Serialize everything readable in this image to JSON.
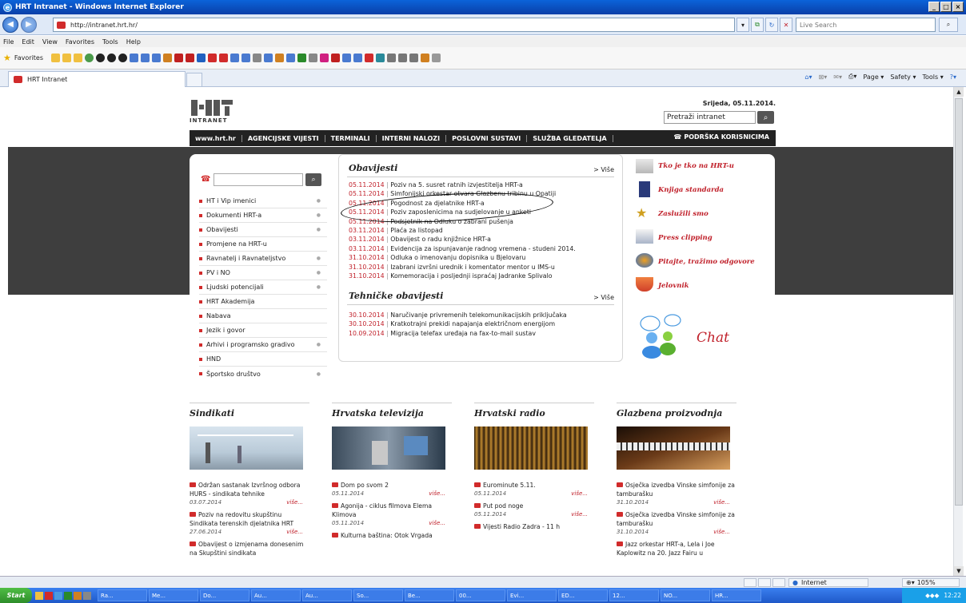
{
  "browser": {
    "title": "HRT Intranet - Windows Internet Explorer",
    "url": "http://intranet.hrt.hr/",
    "live_search_placeholder": "Live Search",
    "menu": [
      "File",
      "Edit",
      "View",
      "Favorites",
      "Tools",
      "Help"
    ],
    "favorites_label": "Favorites",
    "tab_title": "HRT Intranet",
    "command_bar": [
      "Page ▾",
      "Safety ▾",
      "Tools ▾"
    ],
    "status_zone": "Internet",
    "zoom": "105%"
  },
  "header": {
    "logo_text": "INTRANET",
    "date": "Srijeda, 05.11.2014.",
    "search_value": "Pretraži intranet",
    "nav": [
      "www.hrt.hr",
      "AGENCIJSKE VIJESTI",
      "TERMINALI",
      "INTERNI NALOZI",
      "POSLOVNI SUSTAVI",
      "SLUŽBA GLEDATELJA"
    ],
    "support": "PODRŠKA KORISNICIMA"
  },
  "sidenav": [
    "HT i Vip imenici",
    "Dokumenti HRT-a",
    "Obavijesti",
    "Promjene na HRT-u",
    "Ravnatelj i Ravnateljstvo",
    "PV i NO",
    "Ljudski potencijali",
    "HRT Akademija",
    "Nabava",
    "Jezik i govor",
    "Arhivi i programsko gradivo",
    "HND",
    "Športsko društvo"
  ],
  "obavijesti": {
    "title": "Obavijesti",
    "more": "> Više",
    "items": [
      {
        "date": "05.11.2014",
        "text": "Poziv na 5. susret ratnih izvjestitelja HRT-a"
      },
      {
        "date": "05.11.2014",
        "text": "Simfonijski orkestar otvara Glazbenu tribinu u Opatiji"
      },
      {
        "date": "05.11.2014",
        "text": "Pogodnost za djelatnike HRT-a"
      },
      {
        "date": "05.11.2014",
        "text": "Poziv zaposlenicima na sudjelovanje u anketi"
      },
      {
        "date": "05.11.2014",
        "text": "Podsjetnik na Odluku o zabrani pušenja"
      },
      {
        "date": "03.11.2014",
        "text": "Plaća za listopad"
      },
      {
        "date": "03.11.2014",
        "text": "Obavijest o radu knjižnice HRT-a"
      },
      {
        "date": "03.11.2014",
        "text": "Evidencija za ispunjavanje radnog vremena - studeni 2014."
      },
      {
        "date": "31.10.2014",
        "text": "Odluka o imenovanju dopisnika u Bjelovaru"
      },
      {
        "date": "31.10.2014",
        "text": "Izabrani izvršni urednik i komentator mentor u IMS-u"
      },
      {
        "date": "31.10.2014",
        "text": "Komemoracija i posljednji ispraćaj Jadranke Splivalo"
      }
    ]
  },
  "tehnicke": {
    "title": "Tehničke obavijesti",
    "more": "> Više",
    "items": [
      {
        "date": "30.10.2014",
        "text": "Naručivanje privremenih telekomunikacijskih priključaka"
      },
      {
        "date": "30.10.2014",
        "text": "Kratkotrajni prekidi napajanja električnom energijom"
      },
      {
        "date": "10.09.2014",
        "text": "Migracija telefax uređaja na fax-to-mail sustav"
      }
    ]
  },
  "rightlinks": [
    "Tko je tko na HRT-u",
    "Knjiga standarda",
    "Zaslužili smo",
    "Press clipping",
    "Pitajte, tražimo odgovore",
    "Jelovnik"
  ],
  "chat": "Chat",
  "sections": [
    {
      "title": "Sindikati",
      "items": [
        {
          "text": "Održan sastanak Izvršnog odbora HURS - sindikata tehnike",
          "date": "03.07.2014",
          "more": "više..."
        },
        {
          "text": "Poziv na redovitu skupštinu Sindikata terenskih djelatnika HRT",
          "date": "27.06.2014",
          "more": "više..."
        },
        {
          "text": "Obavijest o izmjenama donesenim na Skupštini sindikata",
          "date": "",
          "more": ""
        }
      ]
    },
    {
      "title": "Hrvatska televizija",
      "items": [
        {
          "text": "Dom po svom 2",
          "date": "05.11.2014",
          "more": "više..."
        },
        {
          "text": "Agonija - ciklus filmova Elema Klimova",
          "date": "05.11.2014",
          "more": "više..."
        },
        {
          "text": "Kulturna baština: Otok Vrgada",
          "date": "",
          "more": ""
        }
      ]
    },
    {
      "title": "Hrvatski radio",
      "items": [
        {
          "text": "Eurominute 5.11.",
          "date": "05.11.2014",
          "more": "više..."
        },
        {
          "text": "Put pod noge",
          "date": "05.11.2014",
          "more": "više..."
        },
        {
          "text": "Vijesti Radio Zadra - 11 h",
          "date": "",
          "more": ""
        }
      ]
    },
    {
      "title": "Glazbena proizvodnja",
      "items": [
        {
          "text": "Osječka izvedba Vinske simfonije za tamburašku",
          "date": "31.10.2014",
          "more": "više..."
        },
        {
          "text": "Osječka izvedba Vinske simfonije za tamburašku",
          "date": "31.10.2014",
          "more": "više..."
        },
        {
          "text": "Jazz orkestar HRT-a, Lela i Joe Kaplowitz na 20. Jazz Fairu u",
          "date": "",
          "more": ""
        }
      ]
    }
  ],
  "taskbar": {
    "start": "Start",
    "buttons": [
      "Ra...",
      "Me...",
      "Do...",
      "Au...",
      "Au...",
      "So...",
      "Be...",
      "00...",
      "Evi...",
      "ED...",
      "12...",
      "NO...",
      "HR..."
    ],
    "clock": "12:22"
  }
}
